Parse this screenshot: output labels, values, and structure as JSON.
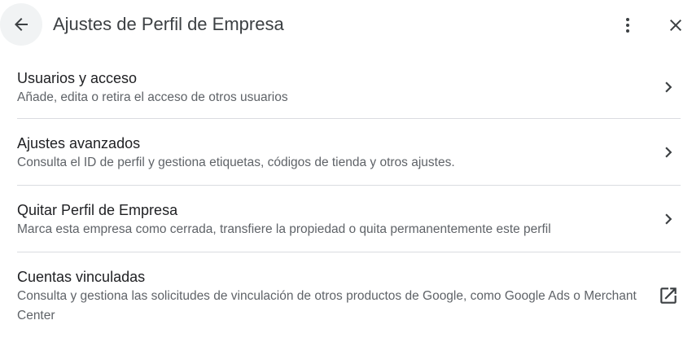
{
  "header": {
    "title": "Ajustes de Perfil de Empresa",
    "back_icon": "arrow-back-icon",
    "menu_icon": "more-vert-icon",
    "close_icon": "close-icon"
  },
  "items": [
    {
      "title": "Usuarios y acceso",
      "subtitle": "Añade, edita o retira el acceso de otros usuarios",
      "icon": "chevron-right-icon"
    },
    {
      "title": "Ajustes avanzados",
      "subtitle": "Consulta el ID de perfil y gestiona etiquetas, códigos de tienda y otros ajustes.",
      "icon": "chevron-right-icon"
    },
    {
      "title": "Quitar Perfil de Empresa",
      "subtitle": "Marca esta empresa como cerrada, transfiere la propiedad o quita permanentemente este perfil",
      "icon": "chevron-right-icon"
    },
    {
      "title": "Cuentas vinculadas",
      "subtitle": "Consulta y gestiona las solicitudes de vinculación de otros productos de Google, como Google Ads o Merchant Center",
      "icon": "open-in-new-icon"
    }
  ]
}
